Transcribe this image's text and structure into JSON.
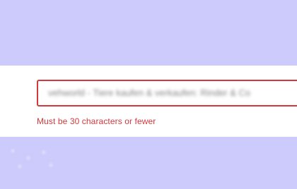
{
  "form": {
    "input_value": "vehworld - Tiere kaufen & verkaufen: Rinder & Co",
    "error_message": "Must be 30 characters or fewer"
  },
  "colors": {
    "background": "#cccbfb",
    "panel": "#ffffff",
    "error": "#d03a3e",
    "input_text": "#6f6f75"
  }
}
